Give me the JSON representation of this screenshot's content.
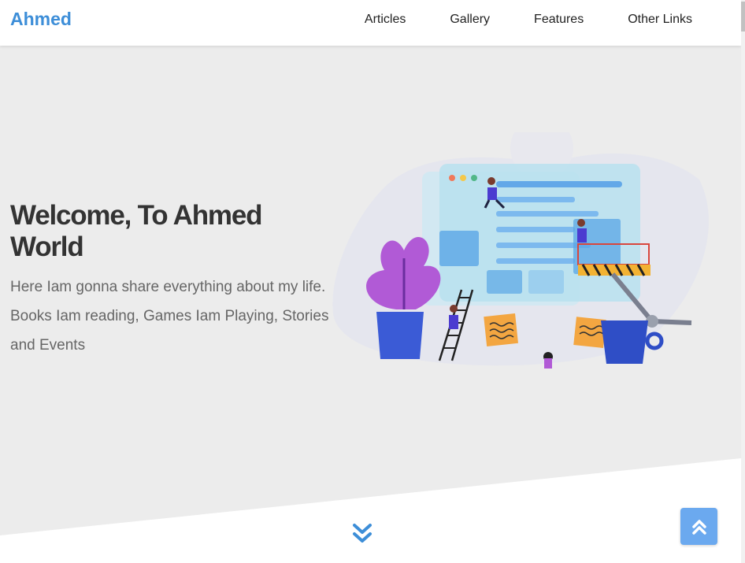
{
  "header": {
    "logo": "Ahmed",
    "nav": [
      "Articles",
      "Gallery",
      "Features",
      "Other Links"
    ]
  },
  "landing": {
    "title": "Welcome, To Ahmed World",
    "description": "Here Iam gonna share everything about my life. Books Iam reading, Games Iam Playing, Stories and Events"
  },
  "icons": {
    "down": "double-chevron-down-icon",
    "up": "double-chevron-up-icon"
  },
  "colors": {
    "brand": "#3d8ed8",
    "accent_button": "#6ba9ef",
    "background": "#ececec"
  }
}
